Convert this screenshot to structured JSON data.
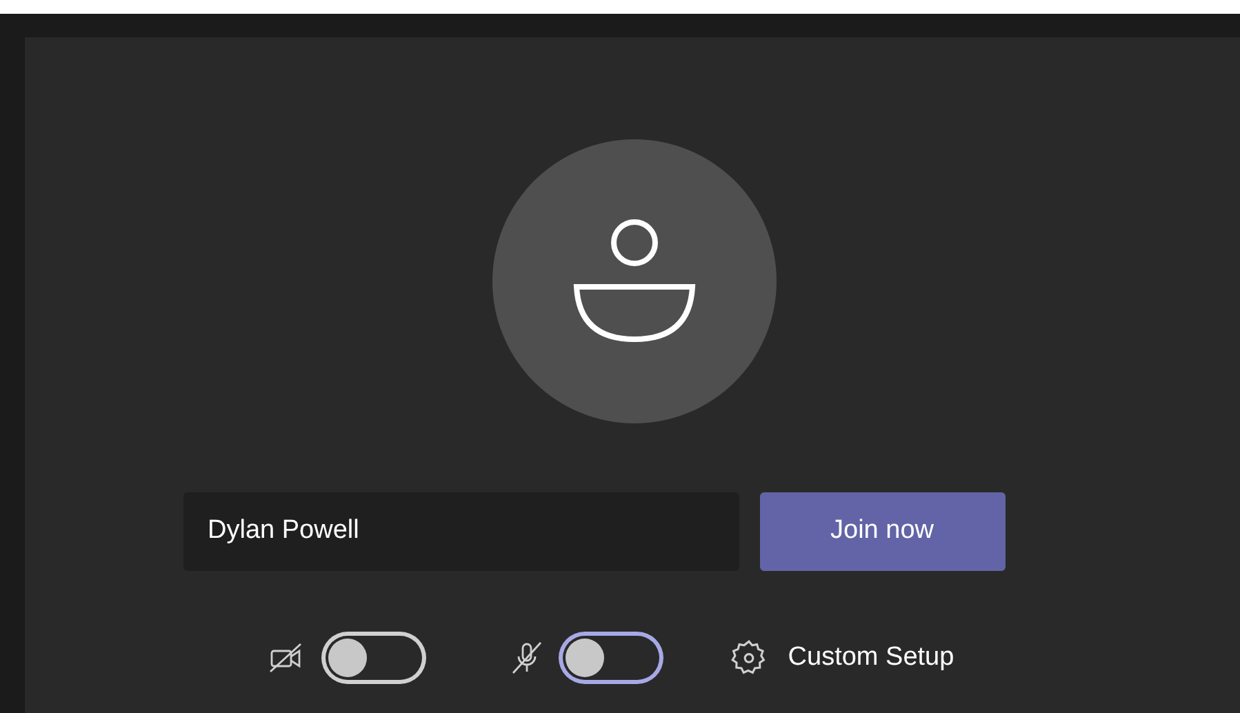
{
  "name_field": {
    "value": "Dylan Powell"
  },
  "join_button": {
    "label": "Join now"
  },
  "toggles": [
    {
      "kind": "camera",
      "on": false,
      "color": "#d0d0d0"
    },
    {
      "kind": "microphone",
      "on": false,
      "color": "#a7a9e6"
    }
  ],
  "settings_button": {
    "label": "Custom Setup"
  }
}
